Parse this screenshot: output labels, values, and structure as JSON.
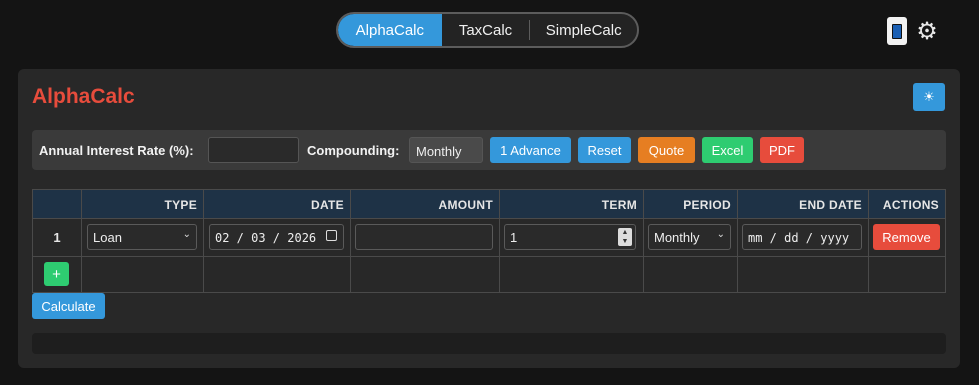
{
  "tabs": [
    {
      "label": "AlphaCalc",
      "active": true
    },
    {
      "label": "TaxCalc",
      "active": false
    },
    {
      "label": "SimpleCalc",
      "active": false
    }
  ],
  "header_icons": {
    "device": "mobile-icon",
    "settings": "gear-icon"
  },
  "panel": {
    "title": "AlphaCalc",
    "theme_toggle_glyph": "☀"
  },
  "controls": {
    "rate_label": "Annual Interest Rate (%):",
    "rate_value": "",
    "compounding_label": "Compounding:",
    "compounding_value": "Monthly",
    "advance_label": "1 Advance",
    "reset_label": "Reset",
    "quote_label": "Quote",
    "excel_label": "Excel",
    "pdf_label": "PDF"
  },
  "table": {
    "columns": [
      "",
      "TYPE",
      "DATE",
      "AMOUNT",
      "TERM",
      "PERIOD",
      "END DATE",
      "ACTIONS"
    ],
    "rows": [
      {
        "num": "1",
        "type": "Loan",
        "date": "02 / 03 / 2026",
        "amount": "",
        "term": "1",
        "period": "Monthly",
        "end_date": "mm / dd / yyyy",
        "action": "Remove"
      }
    ],
    "add_label": "+"
  },
  "calculate_label": "Calculate",
  "colors": {
    "accent_blue": "#3498db",
    "title_red": "#e74c3c",
    "green": "#2ecc71",
    "orange": "#e67e22"
  }
}
